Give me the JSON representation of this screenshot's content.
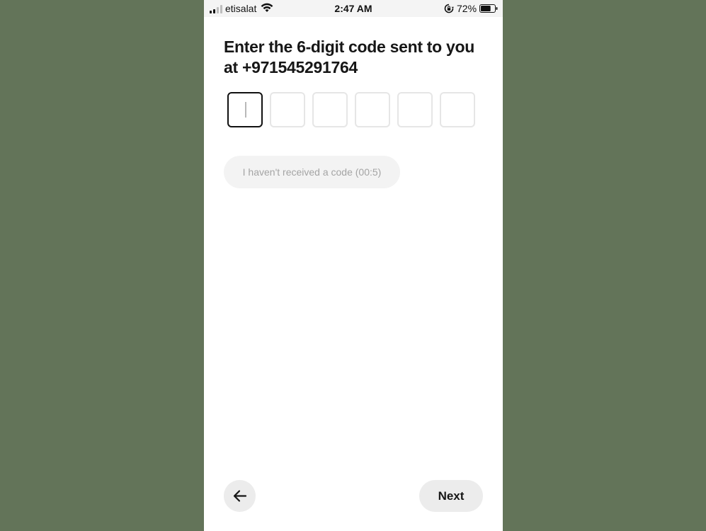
{
  "status_bar": {
    "carrier": "etisalat",
    "time": "2:47 AM",
    "battery_percent": "72%",
    "battery_level": 0.72,
    "signal_bars_filled": 2,
    "signal_bars_total": 4,
    "icons": [
      "signal-icon",
      "wifi-icon",
      "rotation-lock-icon",
      "battery-icon"
    ]
  },
  "verification": {
    "title": "Enter the 6-digit code sent to you at +971545291764",
    "code_length": 6,
    "digits": [
      "",
      "",
      "",
      "",
      "",
      ""
    ],
    "active_index": 0,
    "resend_label": "I haven't received a code (00:5)"
  },
  "footer": {
    "back_icon": "arrow-left-icon",
    "next_label": "Next"
  },
  "colors": {
    "background": "#637459",
    "screen": "#ffffff",
    "text": "#161616",
    "box_border": "#e6e6e6",
    "active_border": "#111111",
    "button_bg": "#ececec",
    "disabled_text": "#a4a4a4"
  }
}
